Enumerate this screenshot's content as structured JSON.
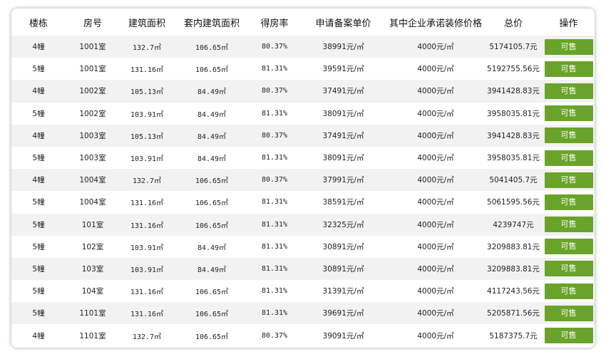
{
  "table": {
    "headers": [
      "楼栋",
      "房号",
      "建筑面积",
      "套内建筑面积",
      "得房率",
      "申请备案单价",
      "其中企业承诺装修价格",
      "总价",
      "操作"
    ],
    "rows": [
      {
        "building": "4幢",
        "room": "1001室",
        "area": "132.7㎡",
        "inner": "106.65㎡",
        "rate": "80.37%",
        "price": "38991元/㎡",
        "deco": "4000元/㎡",
        "total": "5174105.7元",
        "action": "可售"
      },
      {
        "building": "5幢",
        "room": "1001室",
        "area": "131.16㎡",
        "inner": "106.65㎡",
        "rate": "81.31%",
        "price": "39591元/㎡",
        "deco": "4000元/㎡",
        "total": "5192755.56元",
        "action": "可售"
      },
      {
        "building": "4幢",
        "room": "1002室",
        "area": "105.13㎡",
        "inner": "84.49㎡",
        "rate": "80.37%",
        "price": "37491元/㎡",
        "deco": "4000元/㎡",
        "total": "3941428.83元",
        "action": "可售"
      },
      {
        "building": "5幢",
        "room": "1002室",
        "area": "103.91㎡",
        "inner": "84.49㎡",
        "rate": "81.31%",
        "price": "38091元/㎡",
        "deco": "4000元/㎡",
        "total": "3958035.81元",
        "action": "可售"
      },
      {
        "building": "4幢",
        "room": "1003室",
        "area": "105.13㎡",
        "inner": "84.49㎡",
        "rate": "80.37%",
        "price": "37491元/㎡",
        "deco": "4000元/㎡",
        "total": "3941428.83元",
        "action": "可售"
      },
      {
        "building": "5幢",
        "room": "1003室",
        "area": "103.91㎡",
        "inner": "84.49㎡",
        "rate": "81.31%",
        "price": "38091元/㎡",
        "deco": "4000元/㎡",
        "total": "3958035.81元",
        "action": "可售"
      },
      {
        "building": "4幢",
        "room": "1004室",
        "area": "132.7㎡",
        "inner": "106.65㎡",
        "rate": "80.37%",
        "price": "37991元/㎡",
        "deco": "4000元/㎡",
        "total": "5041405.7元",
        "action": "可售"
      },
      {
        "building": "5幢",
        "room": "1004室",
        "area": "131.16㎡",
        "inner": "106.65㎡",
        "rate": "81.31%",
        "price": "38591元/㎡",
        "deco": "4000元/㎡",
        "total": "5061595.56元",
        "action": "可售"
      },
      {
        "building": "5幢",
        "room": "101室",
        "area": "131.16㎡",
        "inner": "106.65㎡",
        "rate": "81.31%",
        "price": "32325元/㎡",
        "deco": "4000元/㎡",
        "total": "4239747元",
        "action": "可售"
      },
      {
        "building": "5幢",
        "room": "102室",
        "area": "103.91㎡",
        "inner": "84.49㎡",
        "rate": "81.31%",
        "price": "30891元/㎡",
        "deco": "4000元/㎡",
        "total": "3209883.81元",
        "action": "可售"
      },
      {
        "building": "5幢",
        "room": "103室",
        "area": "103.91㎡",
        "inner": "84.49㎡",
        "rate": "81.31%",
        "price": "30891元/㎡",
        "deco": "4000元/㎡",
        "total": "3209883.81元",
        "action": "可售"
      },
      {
        "building": "5幢",
        "room": "104室",
        "area": "131.16㎡",
        "inner": "106.65㎡",
        "rate": "81.31%",
        "price": "31391元/㎡",
        "deco": "4000元/㎡",
        "total": "4117243.56元",
        "action": "可售"
      },
      {
        "building": "5幢",
        "room": "1101室",
        "area": "131.16㎡",
        "inner": "106.65㎡",
        "rate": "81.31%",
        "price": "39691元/㎡",
        "deco": "4000元/㎡",
        "total": "5205871.56元",
        "action": "可售"
      },
      {
        "building": "4幢",
        "room": "1101室",
        "area": "132.7㎡",
        "inner": "106.65㎡",
        "rate": "80.37%",
        "price": "39091元/㎡",
        "deco": "4000元/㎡",
        "total": "5187375.7元",
        "action": "可售"
      }
    ]
  },
  "colors": {
    "action_button": "#6aa329",
    "row_stripe": "#f2f2f2"
  }
}
